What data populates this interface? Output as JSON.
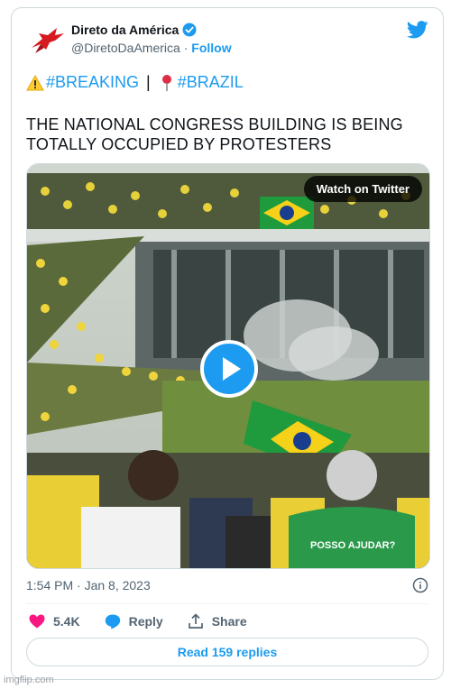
{
  "author": {
    "name": "Direto da América",
    "handle": "@DiretoDaAmerica",
    "separator": "·",
    "follow_label": "Follow",
    "icon": "red-eagle-icon",
    "verified_icon": "verified-badge-icon"
  },
  "hashtags": [
    {
      "icon": "warning-icon",
      "text": "#BREAKING"
    },
    {
      "icon": "round-pushpin-icon",
      "text": "#BRAZIL"
    }
  ],
  "hashtag_separator": "|",
  "tweet_text": "THE NATIONAL CONGRESS BUILDING IS BEING TOTALLY OCCUPIED BY PROTESTERS",
  "media": {
    "watch_label": "Watch on Twitter",
    "play_icon": "play-icon",
    "shirt_text": "POSSO AJUDAR?"
  },
  "timestamp": "1:54 PM · Jan 8, 2023",
  "actions": {
    "likes": "5.4K",
    "reply_label": "Reply",
    "share_label": "Share"
  },
  "read_replies_label": "Read 159 replies",
  "watermark": "imgflip.com",
  "colors": {
    "twitter_blue": "#1d9bf0",
    "like_red": "#f91880",
    "text_secondary": "#536471"
  }
}
